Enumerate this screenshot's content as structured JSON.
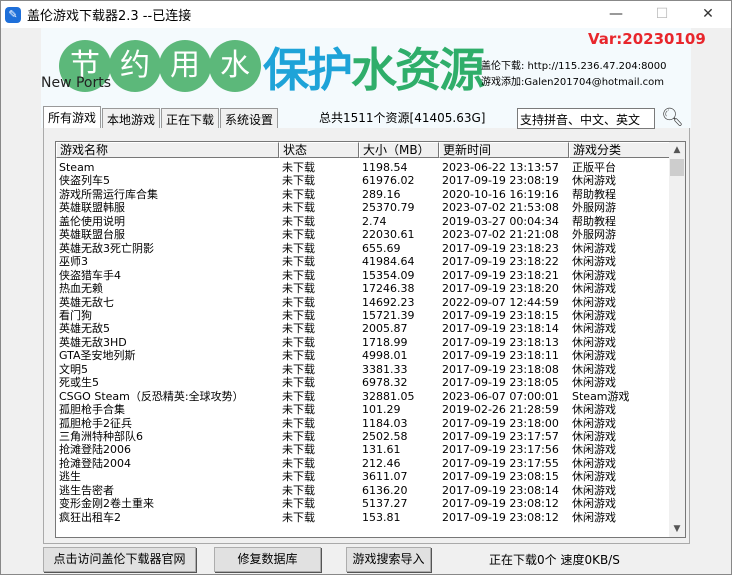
{
  "window": {
    "title": "盖伦游戏下载器2.3 --已连接",
    "minimize": "—",
    "maximize": "☐",
    "close": "✕"
  },
  "banner": {
    "circles": [
      "节",
      "约",
      "用",
      "水"
    ],
    "slogan_blue": "保护",
    "slogan_green": "水资源",
    "version": "Var:20230109",
    "download": "盖伦下载: http://115.236.47.204:8000",
    "contact": "游戏添加:Galen201704@hotmail.com",
    "new_ports": "New Ports"
  },
  "tabs": [
    {
      "label": "所有游戏",
      "active": true
    },
    {
      "label": "本地游戏"
    },
    {
      "label": "正在下载"
    },
    {
      "label": "系统设置"
    }
  ],
  "total": "总共1511个资源[41405.63G]",
  "search": {
    "placeholder": "支持拼音、中文、英文"
  },
  "columns": [
    "游戏名称",
    "状态",
    "大小（MB）",
    "更新时间",
    "游戏分类"
  ],
  "rows": [
    [
      "Steam",
      "未下载",
      "1198.54",
      "2023-06-22 13:13:57",
      "正版平台"
    ],
    [
      "侠盗列车5",
      "未下载",
      "61976.02",
      "2017-09-19 23:08:19",
      "休闲游戏"
    ],
    [
      "游戏所需运行库合集",
      "未下载",
      "289.16",
      "2020-10-16 16:19:16",
      "帮助教程"
    ],
    [
      "英雄联盟韩服",
      "未下载",
      "25370.79",
      "2023-07-02 21:53:08",
      "外服网游"
    ],
    [
      "盖伦使用说明",
      "未下载",
      "2.74",
      "2019-03-27 00:04:34",
      "帮助教程"
    ],
    [
      "英雄联盟台服",
      "未下载",
      "22030.61",
      "2023-07-02 21:21:08",
      "外服网游"
    ],
    [
      "英雄无敌3死亡阴影",
      "未下载",
      "655.69",
      "2017-09-19 23:18:23",
      "休闲游戏"
    ],
    [
      "巫师3",
      "未下载",
      "41984.64",
      "2017-09-19 23:18:22",
      "休闲游戏"
    ],
    [
      "侠盗猎车手4",
      "未下载",
      "15354.09",
      "2017-09-19 23:18:21",
      "休闲游戏"
    ],
    [
      "热血无赖",
      "未下载",
      "17246.38",
      "2017-09-19 23:18:20",
      "休闲游戏"
    ],
    [
      "英雄无敌七",
      "未下载",
      "14692.23",
      "2022-09-07 12:44:59",
      "休闲游戏"
    ],
    [
      "看门狗",
      "未下载",
      "15721.39",
      "2017-09-19 23:18:15",
      "休闲游戏"
    ],
    [
      "英雄无敌5",
      "未下载",
      "2005.87",
      "2017-09-19 23:18:14",
      "休闲游戏"
    ],
    [
      "英雄无敌3HD",
      "未下载",
      "1718.99",
      "2017-09-19 23:18:13",
      "休闲游戏"
    ],
    [
      "GTA圣安地列斯",
      "未下载",
      "4998.01",
      "2017-09-19 23:18:11",
      "休闲游戏"
    ],
    [
      "文明5",
      "未下载",
      "3381.33",
      "2017-09-19 23:18:08",
      "休闲游戏"
    ],
    [
      "死或生5",
      "未下载",
      "6978.32",
      "2017-09-19 23:18:05",
      "休闲游戏"
    ],
    [
      "CSGO Steam（反恐精英:全球攻势）",
      "未下载",
      "32881.05",
      "2023-06-07 07:00:01",
      "Steam游戏"
    ],
    [
      "孤胆枪手合集",
      "未下载",
      "101.29",
      "2019-02-26 21:28:59",
      "休闲游戏"
    ],
    [
      "孤胆枪手2征兵",
      "未下载",
      "1184.03",
      "2017-09-19 23:18:00",
      "休闲游戏"
    ],
    [
      "三角洲特种部队6",
      "未下载",
      "2502.58",
      "2017-09-19 23:17:57",
      "休闲游戏"
    ],
    [
      "抢滩登陆2006",
      "未下载",
      "131.61",
      "2017-09-19 23:17:56",
      "休闲游戏"
    ],
    [
      "抢滩登陆2004",
      "未下载",
      "212.46",
      "2017-09-19 23:17:55",
      "休闲游戏"
    ],
    [
      "逃生",
      "未下载",
      "3611.07",
      "2017-09-19 23:08:15",
      "休闲游戏"
    ],
    [
      "逃生告密者",
      "未下载",
      "6136.20",
      "2017-09-19 23:08:14",
      "休闲游戏"
    ],
    [
      "变形金刚2卷土重来",
      "未下载",
      "5137.27",
      "2017-09-19 23:08:12",
      "休闲游戏"
    ],
    [
      "疯狂出租车2",
      "未下载",
      "153.81",
      "2017-09-19 23:08:12",
      "休闲游戏"
    ]
  ],
  "buttons": {
    "website": "点击访问盖伦下载器官网",
    "repair": "修复数据库",
    "import": "游戏搜索导入"
  },
  "status": "正在下载0个 速度0KB/S"
}
